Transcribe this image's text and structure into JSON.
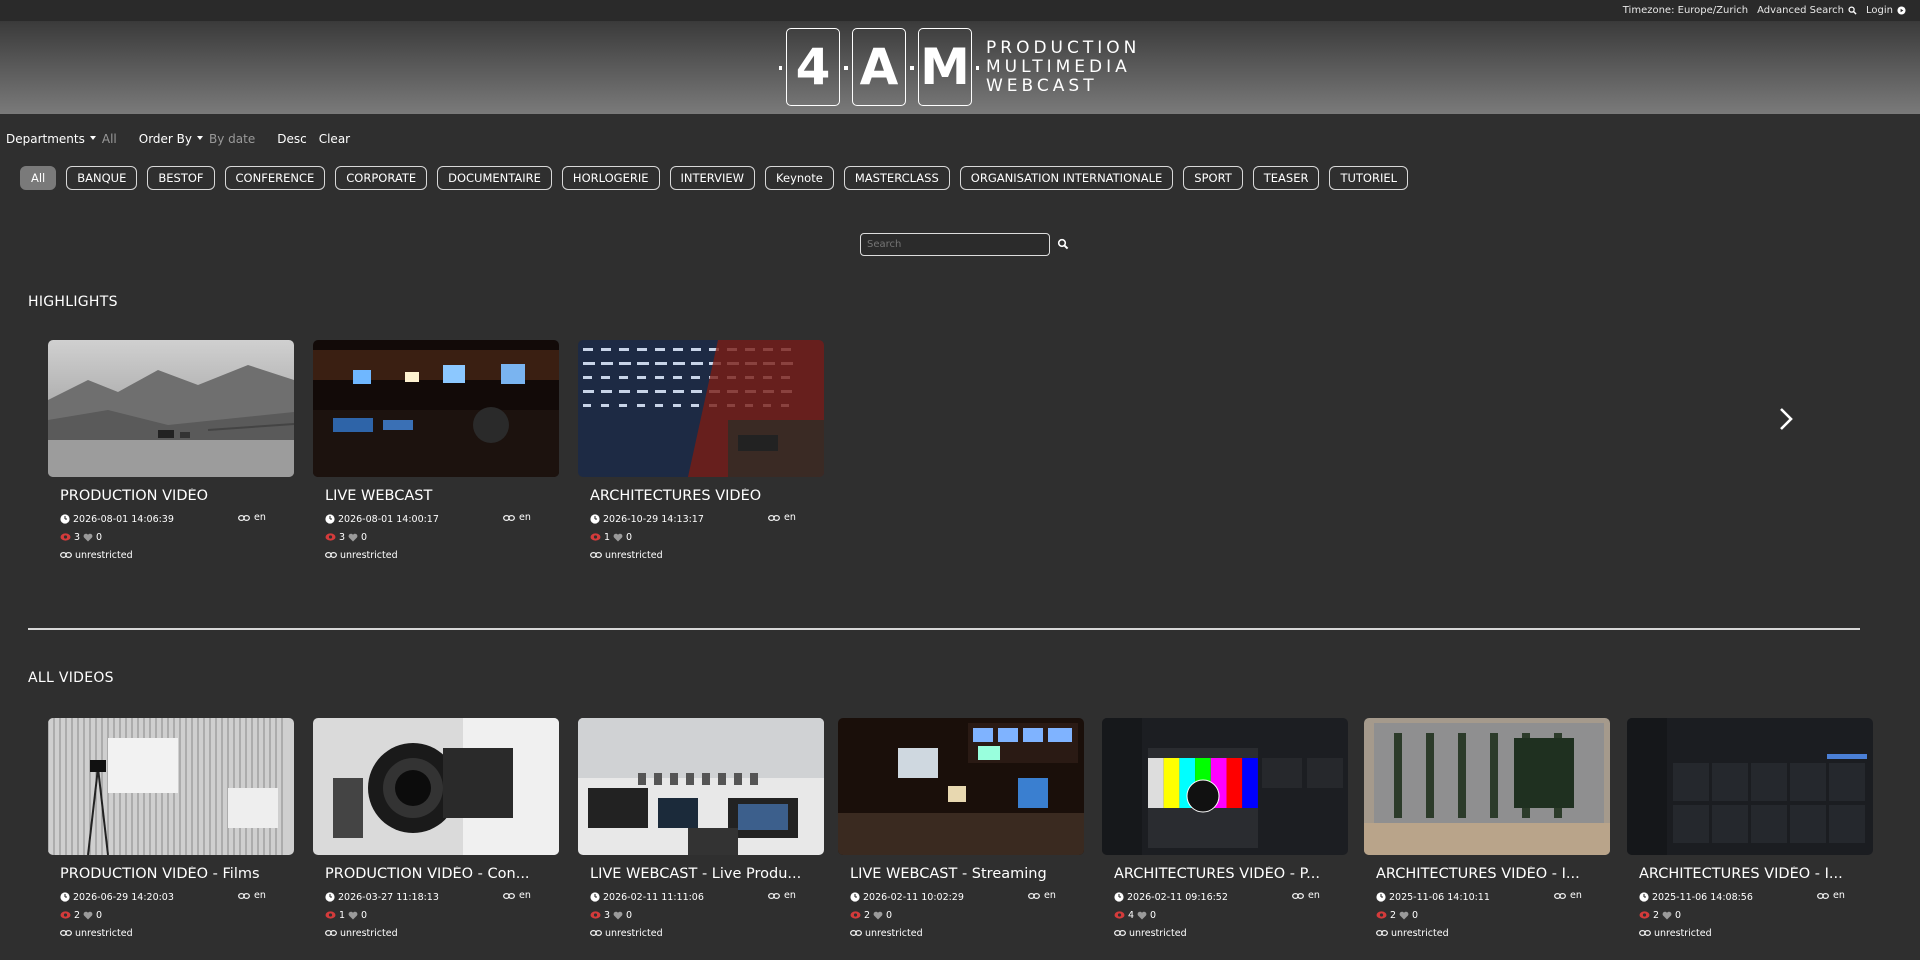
{
  "topbar": {
    "timezone": "Timezone: Europe/Zurich",
    "advanced_search": "Advanced Search",
    "login": "Login"
  },
  "logo": {
    "letters": [
      "4",
      "A",
      "M"
    ],
    "lines": [
      "PRODUCTION",
      "MULTIMEDIA",
      "WEBCAST"
    ]
  },
  "filters": {
    "departments_label": "Departments",
    "departments_value": "All",
    "order_label": "Order By",
    "order_value": "By date",
    "desc": "Desc",
    "clear": "Clear"
  },
  "categories": [
    "All",
    "BANQUE",
    "BESTOF",
    "CONFERENCE",
    "CORPORATE",
    "DOCUMENTAIRE",
    "HORLOGERIE",
    "INTERVIEW",
    "Keynote",
    "MASTERCLASS",
    "ORGANISATION INTERNATIONALE",
    "SPORT",
    "TEASER",
    "TUTORIEL"
  ],
  "search": {
    "placeholder": "Search"
  },
  "highlights": {
    "title": "HIGHLIGHTS",
    "items": [
      {
        "title": "PRODUCTION VIDÉO",
        "date": "2026-08-01 14:06:39",
        "lang": "en",
        "views": "3",
        "likes": "0",
        "access": "unrestricted",
        "thumb": "mountain"
      },
      {
        "title": "LIVE WEBCAST",
        "date": "2026-08-01 14:00:17",
        "lang": "en",
        "views": "3",
        "likes": "0",
        "access": "unrestricted",
        "thumb": "control"
      },
      {
        "title": "ARCHITECTURES VIDÉO",
        "date": "2026-10-29 14:13:17",
        "lang": "en",
        "views": "1",
        "likes": "0",
        "access": "unrestricted",
        "thumb": "rack"
      }
    ]
  },
  "all_videos": {
    "title": "ALL VIDEOS",
    "items": [
      {
        "title": "PRODUCTION VIDÉO - Films",
        "date": "2026-06-29 14:20:03",
        "lang": "en",
        "views": "2",
        "likes": "0",
        "access": "unrestricted",
        "thumb": "studio"
      },
      {
        "title": "PRODUCTION VIDÉO - Con...",
        "date": "2026-03-27 11:18:13",
        "lang": "en",
        "views": "1",
        "likes": "0",
        "access": "unrestricted",
        "thumb": "camera"
      },
      {
        "title": "LIVE WEBCAST - Live Produ...",
        "date": "2026-02-11 11:11:06",
        "lang": "en",
        "views": "3",
        "likes": "0",
        "access": "unrestricted",
        "thumb": "room"
      },
      {
        "title": "LIVE WEBCAST - Streaming",
        "date": "2026-02-11 10:02:29",
        "lang": "en",
        "views": "2",
        "likes": "0",
        "access": "unrestricted",
        "thumb": "regie"
      },
      {
        "title": "ARCHITECTURES VIDÉO - P...",
        "date": "2026-02-11 09:16:52",
        "lang": "en",
        "views": "4",
        "likes": "0",
        "access": "unrestricted",
        "thumb": "dashbars"
      },
      {
        "title": "ARCHITECTURES VIDÉO - I...",
        "date": "2025-11-06 14:10:11",
        "lang": "en",
        "views": "2",
        "likes": "0",
        "access": "unrestricted",
        "thumb": "cards"
      },
      {
        "title": "ARCHITECTURES VIDÉO - I...",
        "date": "2025-11-06 14:08:56",
        "lang": "en",
        "views": "2",
        "likes": "0",
        "access": "unrestricted",
        "thumb": "dashgrid"
      }
    ]
  },
  "icons": {
    "search": "search-icon",
    "login": "login-icon",
    "clock": "clock-icon",
    "eye": "eye-icon",
    "heart": "heart-icon",
    "link": "link-icon",
    "next": "chevron-right-icon"
  }
}
